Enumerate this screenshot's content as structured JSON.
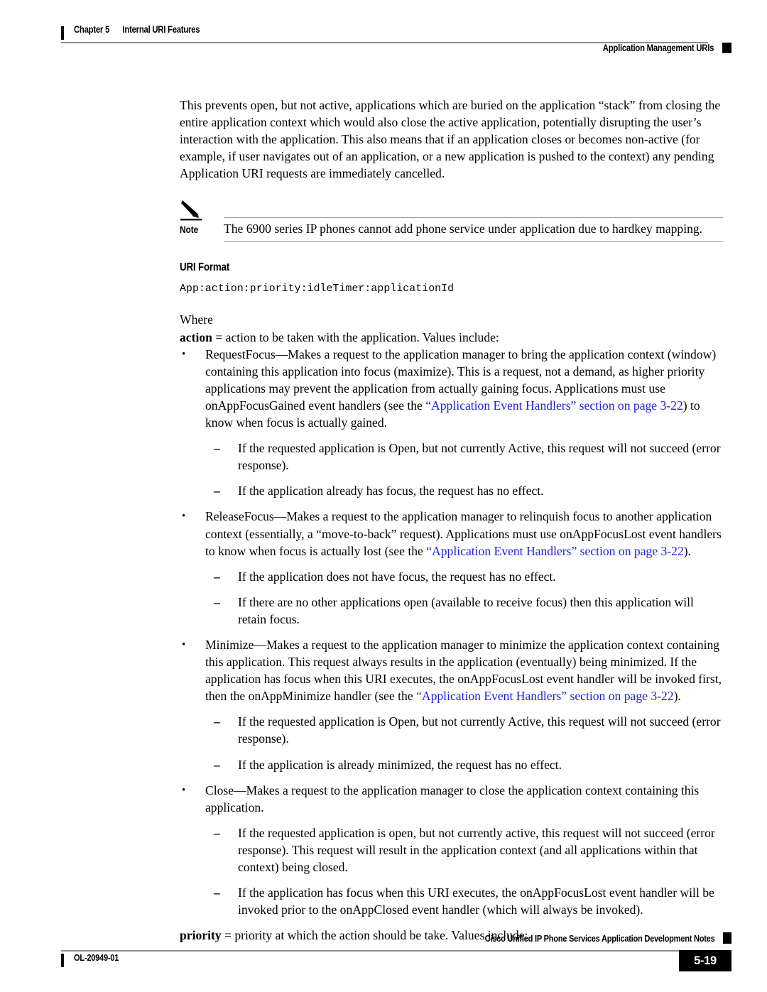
{
  "header": {
    "chapter_number": "Chapter 5",
    "chapter_title": "Internal URI Features",
    "section_title": "Application Management URIs"
  },
  "footer": {
    "document_title": "Cisco Unified IP Phone Services Application Development Notes",
    "doc_id": "OL-20949-01",
    "page_number": "5-19"
  },
  "body": {
    "intro_paragraph": "This prevents open, but not active, applications which are buried on the application “stack” from closing the entire application context which would also close the active application, potentially disrupting the user’s interaction with the application. This also means that if an application closes or becomes non-active (for example, if user navigates out of an application, or a new application is pushed to the context) any pending Application URI requests are immediately cancelled.",
    "note": {
      "label": "Note",
      "text": "The 6900 series IP phones cannot add phone service under application due to hardkey mapping."
    },
    "uri_format_heading": "URI Format",
    "uri_format_code": "App:action:priority:idleTimer:applicationId",
    "where_label": "Where",
    "action_definition_term": "action",
    "action_definition_text": " = action to be taken with the application. Values include:",
    "bullets": [
      {
        "marker": "•",
        "segments": [
          {
            "text": "RequestFocus—Makes a request to the application manager to bring the application context (window) containing this application into focus (maximize). This is a request, not a demand, as higher priority applications may prevent the application from actually gaining focus. Applications must use onAppFocusGained event handlers (see the ",
            "style": "plain"
          },
          {
            "text": "“Application Event Handlers” section on page 3-22",
            "style": "link"
          },
          {
            "text": ") to know when focus is actually gained.",
            "style": "plain"
          }
        ],
        "subitems": [
          {
            "marker": "–",
            "text": "If the requested application is Open, but not currently Active, this request will not succeed (error response)."
          },
          {
            "marker": "–",
            "text": "If the application already has focus, the request has no effect."
          }
        ]
      },
      {
        "marker": "•",
        "segments": [
          {
            "text": "ReleaseFocus—Makes a request to the application manager to relinquish focus to another application context (essentially, a “move-to-back” request). Applications must use onAppFocusLost event handlers to know when focus is actually lost (see the ",
            "style": "plain"
          },
          {
            "text": "“Application Event Handlers” section on page 3-22",
            "style": "link"
          },
          {
            "text": ").",
            "style": "plain"
          }
        ],
        "subitems": [
          {
            "marker": "–",
            "text": "If the application does not have focus, the request has no effect."
          },
          {
            "marker": "–",
            "text": "If there are no other applications open (available to receive focus) then this application will retain focus."
          }
        ]
      },
      {
        "marker": "•",
        "segments": [
          {
            "text": "Minimize—Makes a request to the application manager to minimize the application context containing this application. This request always results in the application (eventually) being minimized. If the application has focus when this URI executes, the onAppFocusLost event handler will be invoked first, then the onAppMinimize handler (see the ",
            "style": "plain"
          },
          {
            "text": "“Application Event Handlers” section on page 3-22",
            "style": "link"
          },
          {
            "text": ").",
            "style": "plain"
          }
        ],
        "subitems": [
          {
            "marker": "–",
            "text": "If the requested application is Open, but not currently Active, this request will not succeed (error response)."
          },
          {
            "marker": "–",
            "text": "If the application is already minimized, the request has no effect."
          }
        ]
      },
      {
        "marker": "•",
        "segments": [
          {
            "text": "Close—Makes a request to the application manager to close the application context containing this application.",
            "style": "plain"
          }
        ],
        "subitems": [
          {
            "marker": "–",
            "text": "If the requested application is open, but not currently active, this request will not succeed (error response). This request will result in the application context (and all applications within that context) being closed."
          },
          {
            "marker": "–",
            "text": "If the application has focus when this URI executes, the onAppFocusLost event handler will be invoked prior to the onAppClosed event handler (which will always be invoked)."
          }
        ]
      }
    ],
    "priority_definition_term": "priority",
    "priority_definition_text": " = priority at which the action should be take. Values include:"
  },
  "colors": {
    "link": "#2020dd",
    "rule": "#8d8d8d",
    "text": "#000000",
    "page_number_bg": "#000000"
  },
  "icons": {
    "note": "pencil-icon"
  }
}
